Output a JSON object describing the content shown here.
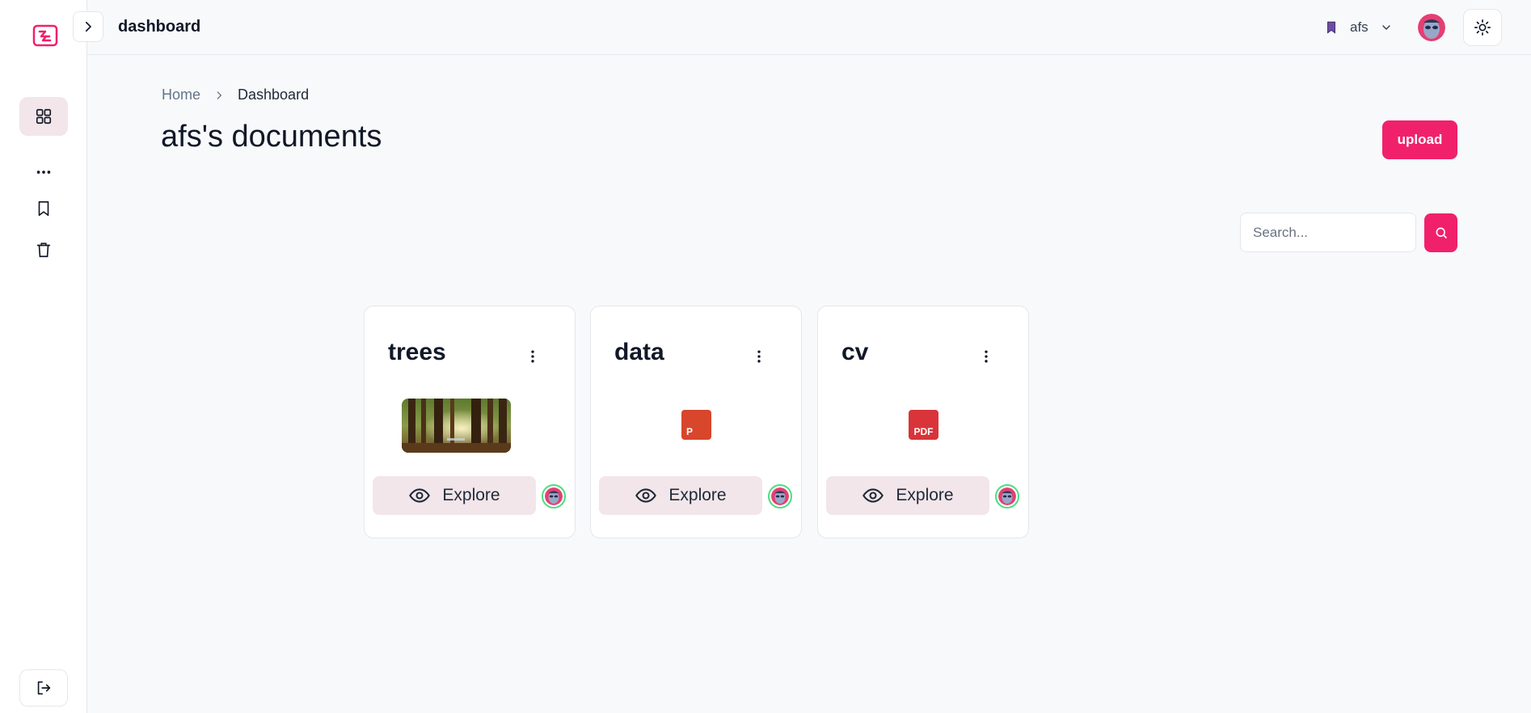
{
  "header": {
    "title": "dashboard",
    "workspace": "afs"
  },
  "breadcrumb": {
    "home": "Home",
    "current": "Dashboard"
  },
  "page": {
    "title": "afs's documents",
    "upload_label": "upload"
  },
  "search": {
    "placeholder": "Search..."
  },
  "documents": [
    {
      "title": "trees",
      "type": "image",
      "explore_label": "Explore"
    },
    {
      "title": "data",
      "type": "powerpoint",
      "badge": "P",
      "explore_label": "Explore"
    },
    {
      "title": "cv",
      "type": "pdf",
      "badge": "PDF",
      "explore_label": "Explore"
    }
  ],
  "colors": {
    "accent": "#f0216a",
    "accent_soft": "#f2e6ea",
    "ppt": "#d8462b",
    "pdf": "#d8343a",
    "avatar_ring": "#4ade80"
  },
  "icons": {
    "logo": "logo-icon",
    "dashboard": "grid-icon",
    "more": "more-horizontal-icon",
    "bookmark": "bookmark-icon",
    "trash": "trash-icon",
    "logout": "logout-icon",
    "collapse": "chevron-right-icon",
    "theme": "sun-icon",
    "search": "search-icon",
    "explore": "eye-icon",
    "menu": "more-vertical-icon"
  }
}
